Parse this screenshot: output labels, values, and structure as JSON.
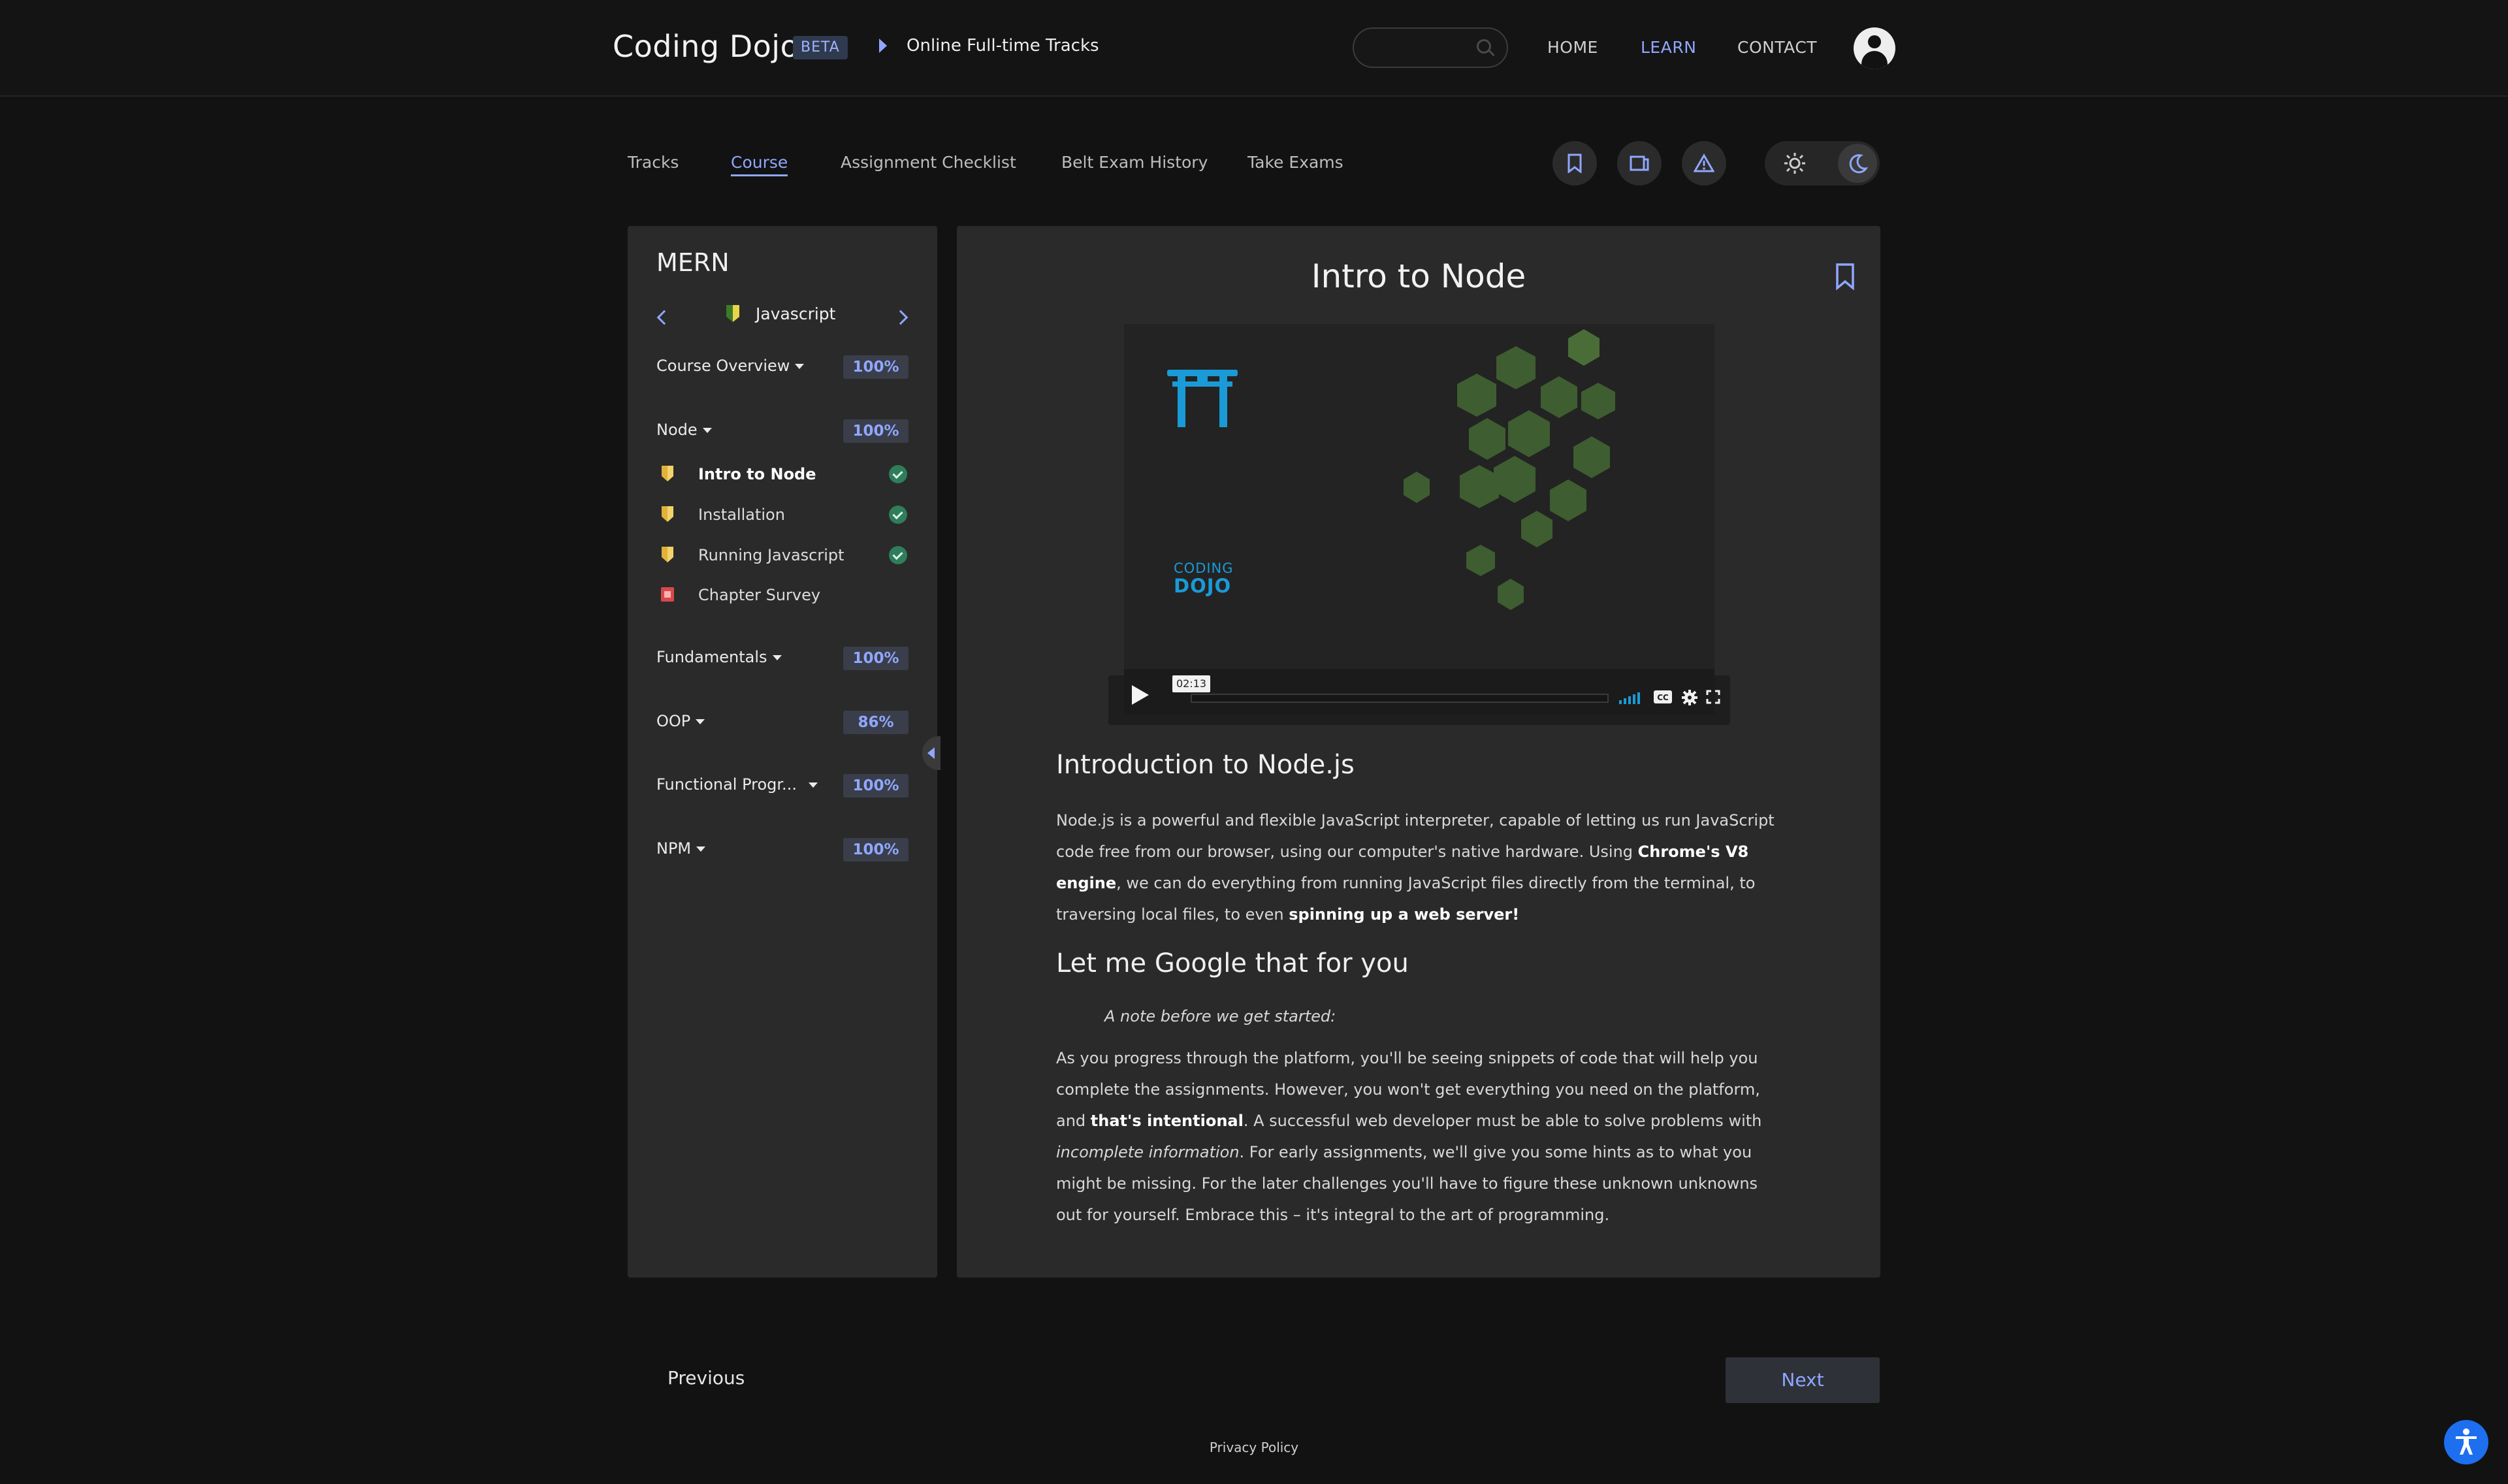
{
  "header": {
    "brand": "Coding Dojo",
    "beta": "BETA",
    "breadcrumb": "Online Full-time Tracks",
    "search_placeholder": "",
    "nav": [
      "HOME",
      "LEARN",
      "CONTACT"
    ]
  },
  "tabs": [
    "Tracks",
    "Course",
    "Assignment Checklist",
    "Belt Exam History",
    "Take Exams"
  ],
  "sidebar": {
    "title": "MERN",
    "language": "Javascript",
    "sections": [
      {
        "label": "Course Overview",
        "pct": "100%"
      },
      {
        "label": "Node",
        "pct": "100%"
      },
      {
        "label": "Fundamentals",
        "pct": "100%"
      },
      {
        "label": "OOP",
        "pct": "86%"
      },
      {
        "label": "Functional Progr...",
        "pct": "100%"
      },
      {
        "label": "NPM",
        "pct": "100%"
      }
    ],
    "node_items": [
      "Intro to Node",
      "Installation",
      "Running Javascript",
      "Chapter Survey"
    ]
  },
  "lesson": {
    "title": "Intro to Node",
    "video_time": "02:13",
    "video_logo_top": "CODING",
    "video_logo_bottom": "DOJO",
    "h2_intro": "Introduction to Node.js",
    "p1_a": "Node.js is a powerful and flexible JavaScript interpreter, capable of letting us run JavaScript code free from our browser, using our computer's native hardware. Using ",
    "p1_b": "Chrome's V8 engine",
    "p1_c": ", we can do everything from running JavaScript files directly from the terminal, to traversing local files, to even ",
    "p1_d": "spinning up a web server!",
    "h2_google": "Let me Google that for you",
    "note": "A note before we get started:",
    "p2_a": "As you progress through the platform, you'll be seeing snippets of code that will help you complete the assignments. However, you won't get everything you need on the platform, and ",
    "p2_b": "that's intentional",
    "p2_c": ". A successful web developer must be able to solve problems with ",
    "p2_d": "incomplete information",
    "p2_e": ". For early assignments, we'll give you some hints as to what you might be missing. For the later challenges you'll have to figure these unknown unknowns out for yourself. Embrace this – it's integral to the art of programming."
  },
  "footer": {
    "previous": "Previous",
    "next": "Next",
    "privacy": "Privacy Policy"
  },
  "colors": {
    "accent": "#8fa7ff",
    "background": "#121212",
    "panel": "#2a2a2a",
    "badge_bg": "#3a3e4a",
    "check_green": "#2f7d5a",
    "a11y_blue": "#1e6ff0"
  },
  "icons": [
    "search-icon",
    "user-avatar-icon",
    "bookmark-icon",
    "book-icon",
    "warning-icon",
    "sun-icon",
    "moon-icon",
    "play-icon",
    "volume-icon",
    "captions-icon",
    "settings-icon",
    "fullscreen-icon",
    "accessibility-icon"
  ]
}
